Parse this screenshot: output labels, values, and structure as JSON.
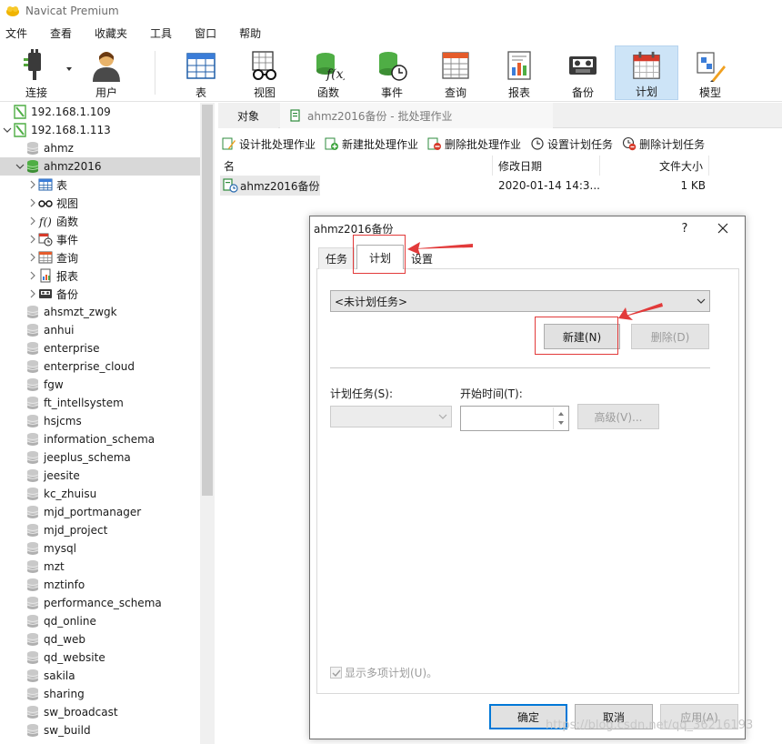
{
  "window": {
    "title": "Navicat Premium"
  },
  "menu": [
    "文件",
    "查看",
    "收藏夹",
    "工具",
    "窗口",
    "帮助"
  ],
  "toolbar": [
    {
      "label": "连接",
      "icon": "plug-icon"
    },
    {
      "label": "用户",
      "icon": "user-icon"
    },
    {
      "label": "表",
      "icon": "table-icon"
    },
    {
      "label": "视图",
      "icon": "view-glasses-icon"
    },
    {
      "label": "函数",
      "icon": "function-icon"
    },
    {
      "label": "事件",
      "icon": "event-clock-icon"
    },
    {
      "label": "查询",
      "icon": "query-grid-icon"
    },
    {
      "label": "报表",
      "icon": "report-icon"
    },
    {
      "label": "备份",
      "icon": "backup-cassette-icon"
    },
    {
      "label": "计划",
      "icon": "calendar-icon",
      "active": true
    },
    {
      "label": "模型",
      "icon": "model-icon"
    }
  ],
  "sidebar": {
    "items": [
      {
        "label": "192.168.1.109",
        "type": "connection",
        "level": 0,
        "expander": "none"
      },
      {
        "label": "192.168.1.113",
        "type": "connection",
        "level": 0,
        "expander": "open"
      },
      {
        "label": "ahmz",
        "type": "database",
        "level": 1,
        "expander": "none"
      },
      {
        "label": "ahmz2016",
        "type": "database-active",
        "level": 1,
        "expander": "open",
        "selected": true
      },
      {
        "label": "表",
        "type": "table",
        "level": 2,
        "expander": "closed"
      },
      {
        "label": "视图",
        "type": "view",
        "level": 2,
        "expander": "closed"
      },
      {
        "label": "函数",
        "type": "function",
        "level": 2,
        "expander": "closed"
      },
      {
        "label": "事件",
        "type": "event",
        "level": 2,
        "expander": "closed"
      },
      {
        "label": "查询",
        "type": "query",
        "level": 2,
        "expander": "closed"
      },
      {
        "label": "报表",
        "type": "report",
        "level": 2,
        "expander": "closed"
      },
      {
        "label": "备份",
        "type": "backup",
        "level": 2,
        "expander": "closed"
      },
      {
        "label": "ahsmzt_zwgk",
        "type": "database",
        "level": 1,
        "expander": "none"
      },
      {
        "label": "anhui",
        "type": "database",
        "level": 1,
        "expander": "none"
      },
      {
        "label": "enterprise",
        "type": "database",
        "level": 1,
        "expander": "none"
      },
      {
        "label": "enterprise_cloud",
        "type": "database",
        "level": 1,
        "expander": "none"
      },
      {
        "label": "fgw",
        "type": "database",
        "level": 1,
        "expander": "none"
      },
      {
        "label": "ft_intellsystem",
        "type": "database",
        "level": 1,
        "expander": "none"
      },
      {
        "label": "hsjcms",
        "type": "database",
        "level": 1,
        "expander": "none"
      },
      {
        "label": "information_schema",
        "type": "database",
        "level": 1,
        "expander": "none"
      },
      {
        "label": "jeeplus_schema",
        "type": "database",
        "level": 1,
        "expander": "none"
      },
      {
        "label": "jeesite",
        "type": "database",
        "level": 1,
        "expander": "none"
      },
      {
        "label": "kc_zhuisu",
        "type": "database",
        "level": 1,
        "expander": "none"
      },
      {
        "label": "mjd_portmanager",
        "type": "database",
        "level": 1,
        "expander": "none"
      },
      {
        "label": "mjd_project",
        "type": "database",
        "level": 1,
        "expander": "none"
      },
      {
        "label": "mysql",
        "type": "database",
        "level": 1,
        "expander": "none"
      },
      {
        "label": "mzt",
        "type": "database",
        "level": 1,
        "expander": "none"
      },
      {
        "label": "mztinfo",
        "type": "database",
        "level": 1,
        "expander": "none"
      },
      {
        "label": "performance_schema",
        "type": "database",
        "level": 1,
        "expander": "none"
      },
      {
        "label": "qd_online",
        "type": "database",
        "level": 1,
        "expander": "none"
      },
      {
        "label": "qd_web",
        "type": "database",
        "level": 1,
        "expander": "none"
      },
      {
        "label": "qd_website",
        "type": "database",
        "level": 1,
        "expander": "none"
      },
      {
        "label": "sakila",
        "type": "database",
        "level": 1,
        "expander": "none"
      },
      {
        "label": "sharing",
        "type": "database",
        "level": 1,
        "expander": "none"
      },
      {
        "label": "sw_broadcast",
        "type": "database",
        "level": 1,
        "expander": "none"
      },
      {
        "label": "sw_build",
        "type": "database",
        "level": 1,
        "expander": "none"
      }
    ]
  },
  "tabs": {
    "objects": "对象",
    "document": "ahmz2016备份 - 批处理作业"
  },
  "object_toolbar": [
    {
      "label": "设计批处理作业",
      "icon": "design-batch-icon"
    },
    {
      "label": "新建批处理作业",
      "icon": "new-batch-icon"
    },
    {
      "label": "删除批处理作业",
      "icon": "delete-batch-icon"
    },
    {
      "label": "设置计划任务",
      "icon": "schedule-clock-icon"
    },
    {
      "label": "删除计划任务",
      "icon": "delete-schedule-icon"
    }
  ],
  "list": {
    "columns": [
      "名",
      "修改日期",
      "文件大小"
    ],
    "rows": [
      {
        "name": "ahmz2016备份",
        "modified": "2020-01-14 14:3...",
        "size": "1 KB"
      }
    ]
  },
  "dialog": {
    "title": "ahmz2016备份",
    "help": "?",
    "tabs": [
      "任务",
      "计划",
      "设置"
    ],
    "active_tab": "计划",
    "schedule_combo": "<未计划任务>",
    "new_button": "新建(N)",
    "delete_button": "删除(D)",
    "task_label": "计划任务(S):",
    "start_time_label": "开始时间(T):",
    "advanced_button": "高级(V)...",
    "show_multiple": "显示多项计划(U)。",
    "ok": "确定",
    "cancel": "取消",
    "apply": "应用(A)"
  },
  "watermark": "https://blog.csdn.net/qq_36216193"
}
